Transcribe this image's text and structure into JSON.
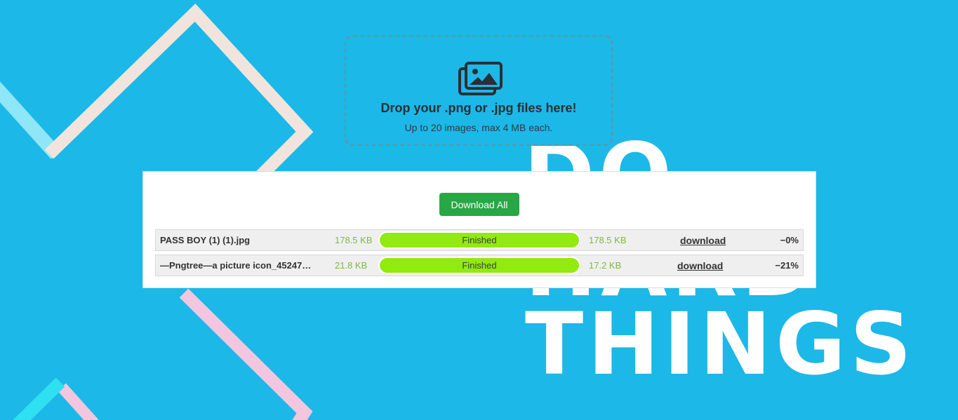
{
  "background": {
    "words": [
      "DO",
      "HARD",
      "THINGS"
    ],
    "colors": {
      "sky": "#1cb8e8",
      "peach": "#f1e4dc",
      "pink": "#f2c6df",
      "light_cyan": "#8fe6f6",
      "cyan": "#2fe0f0"
    }
  },
  "dropzone": {
    "icon": "images-stack-icon",
    "title": "Drop your .png or .jpg files here!",
    "subtitle": "Up to 20 images, max 4 MB each."
  },
  "panel": {
    "download_all_label": "Download All",
    "files": [
      {
        "name": "PASS BOY (1) (1).jpg",
        "original_size": "178.5 KB",
        "status": "Finished",
        "progress_percent": 100,
        "new_size": "178.5 KB",
        "download_label": "download",
        "saving": "−0%"
      },
      {
        "name": "—Pngtree—a picture icon_45247…",
        "original_size": "21.8 KB",
        "status": "Finished",
        "progress_percent": 100,
        "new_size": "17.2 KB",
        "download_label": "download",
        "saving": "−21%"
      }
    ]
  },
  "accent_colors": {
    "button": "#28a745",
    "progress": "#92ea0f",
    "size_text": "#7dbb3c"
  }
}
